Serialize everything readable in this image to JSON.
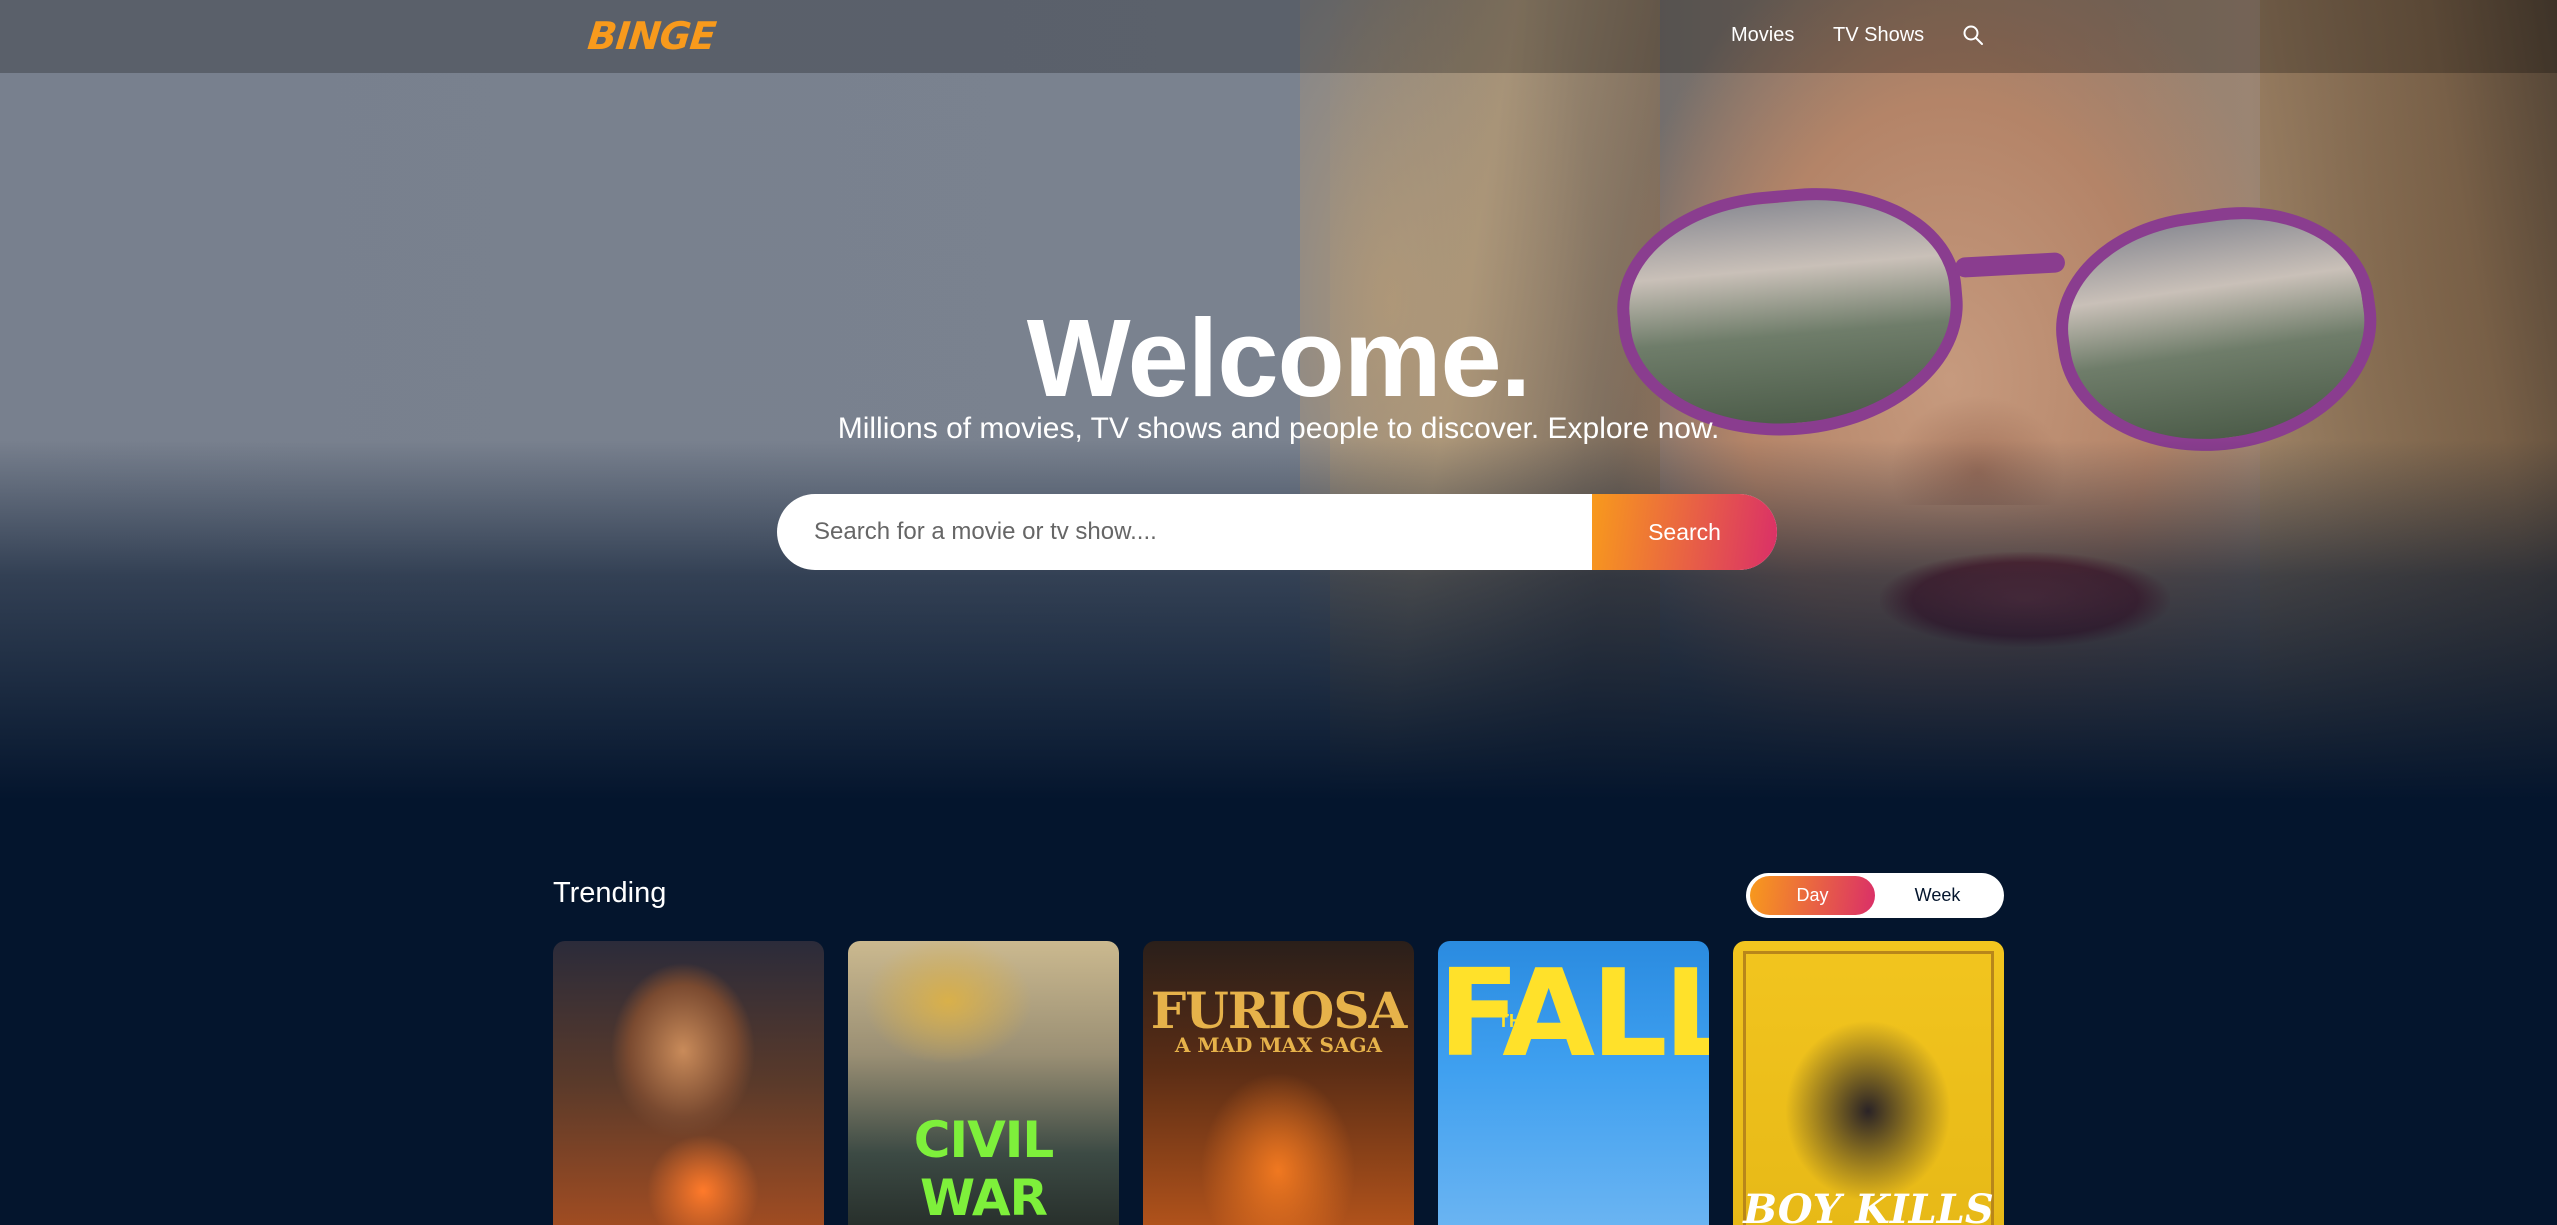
{
  "header": {
    "logo": "BINGE",
    "nav": {
      "movies": "Movies",
      "tv_shows": "TV Shows"
    }
  },
  "hero": {
    "title": "Welcome.",
    "subtitle": "Millions of movies, TV shows and people to discover. Explore now.",
    "search": {
      "placeholder": "Search for a movie or tv show....",
      "value": "",
      "button": "Search"
    }
  },
  "trending": {
    "title": "Trending",
    "tabs": {
      "day": "Day",
      "week": "Week"
    },
    "selected_tab": "Day",
    "posters": [
      {
        "title": ""
      },
      {
        "title": "CIVIL WAR"
      },
      {
        "title": "FURIOSA",
        "subtitle": "A MAD MAX SAGA"
      },
      {
        "title": "FALL",
        "prefix": "THE"
      },
      {
        "title": "BOY KILLS"
      }
    ]
  },
  "colors": {
    "background": "#04152d",
    "accent_orange": "#f89a1c",
    "accent_pink": "#da2f68"
  }
}
